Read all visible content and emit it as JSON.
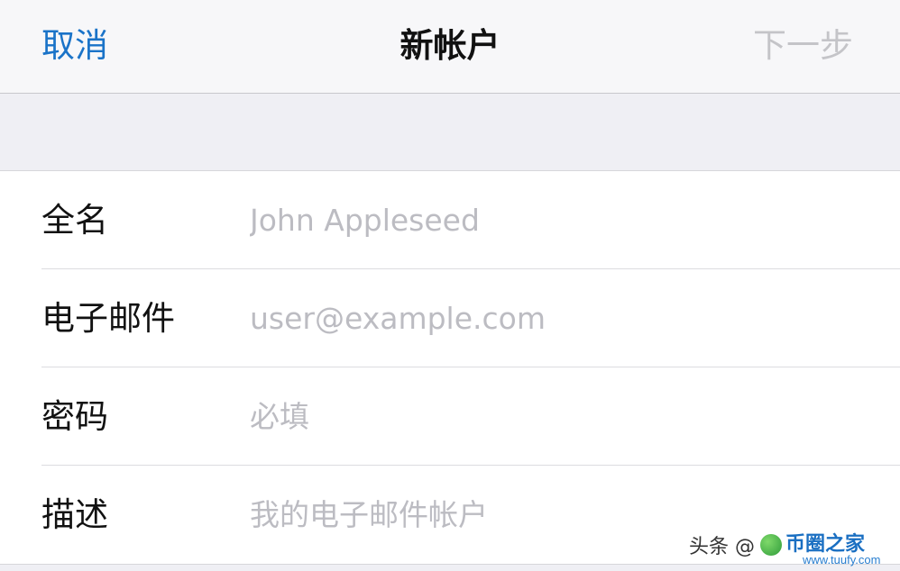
{
  "navbar": {
    "cancel_label": "取消",
    "title": "新帐户",
    "next_label": "下一步"
  },
  "form": {
    "rows": [
      {
        "label": "全名",
        "placeholder": "John Appleseed",
        "value": ""
      },
      {
        "label": "电子邮件",
        "placeholder": "user@example.com",
        "value": ""
      },
      {
        "label": "密码",
        "placeholder": "必填",
        "value": ""
      },
      {
        "label": "描述",
        "placeholder": "我的电子邮件帐户",
        "value": ""
      }
    ]
  },
  "watermark": {
    "prefix": "头条 @",
    "brand": "币圈之家",
    "url": "www.tuufy.com"
  },
  "colors": {
    "accent": "#1a73c8",
    "disabled": "#c4c4c8",
    "placeholder": "#bcbcc2",
    "background": "#efeff4"
  }
}
